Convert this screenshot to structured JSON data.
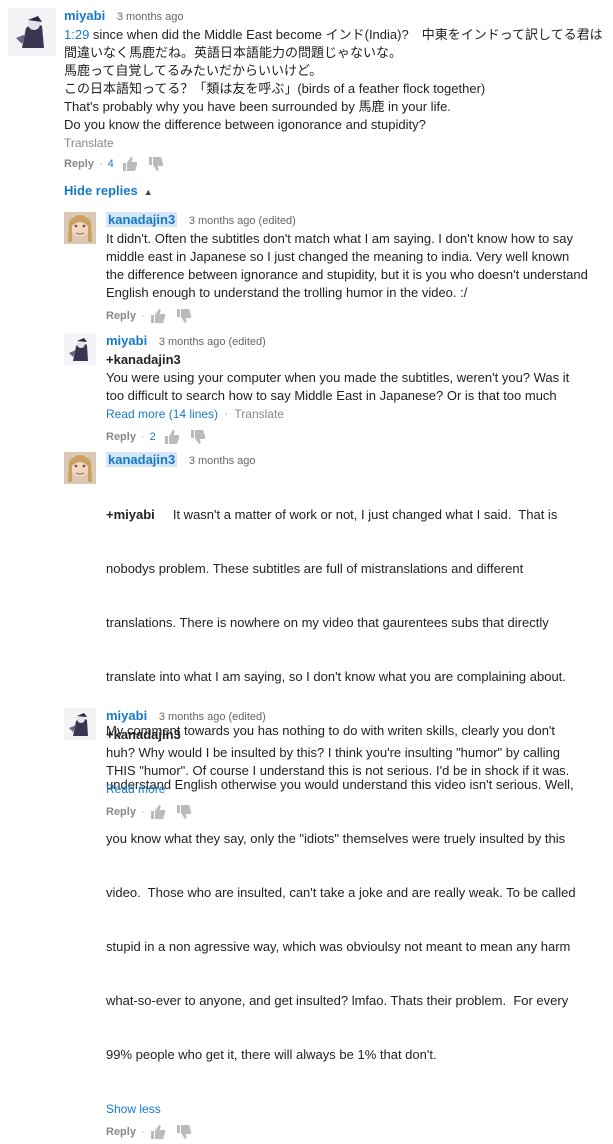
{
  "top_comment": {
    "author": "miyabi",
    "time": "3 months ago",
    "timestamp_link": "1:29",
    "lines": [
      " since when did the Middle East become インド(India)?　中東をインドって訳してる君は",
      "間違いなく馬鹿だね。英語日本語能力の問題じゃないな。",
      "馬鹿って自覚してるみたいだからいいけど。",
      "この日本語知ってる？「類は友を呼ぶ」(birds of a feather flock together)",
      "That's probably why you have been surrounded by 馬鹿 in your life.",
      "Do you know the difference between igonorance and stupidity?"
    ],
    "translate": "Translate",
    "reply_label": "Reply",
    "likes": "4"
  },
  "hide_replies_label": "Hide replies",
  "replies": [
    {
      "author": "kanadajin3",
      "time": "3 months ago (edited)",
      "lines": [
        "It didn't. Often the subtitles don't match what I am saying.  I don't know how to say",
        "middle east in Japanese so I just changed the meaning to india. Very well known",
        "the difference between ignorance and stupidity, but it is you who doesn't understand",
        "English enough to understand the trolling humor in the video. :/"
      ],
      "reply_label": "Reply"
    },
    {
      "author": "miyabi",
      "time": "3 months ago (edited)",
      "mention": "+kanadajin3",
      "lines": [
        "You were using your computer when you made the subtitles, weren't you? Was it",
        "too difficult to search how to say Middle East in Japanese? Or is that too much"
      ],
      "read_more": "Read more (14 lines)",
      "translate": "Translate",
      "reply_label": "Reply",
      "likes": "2"
    },
    {
      "author": "kanadajin3",
      "time": "3 months ago",
      "mention": "+miyabi",
      "first_line_rest": "     It wasn't a matter of work or not, I just changed what I said.  That is",
      "lines": [
        "nobodys problem. These subtitles are full of mistranslations and different",
        "translations. There is nowhere on my video that gaurentees subs that directly",
        "translate into what I am saying, so I don't know what you are complaining about.",
        "My comment towards you has nothing to do with writen skills, clearly you don't",
        "understand English otherwise you would understand this video isn't serious. Well,",
        "you know what they say, only the \"idiots\" themselves were truely insulted by this",
        "video.  Those who are insulted, can't take a joke and are really weak. To be called",
        "stupid in a non agressive way, which was obvioulsy not meant to mean any harm",
        "what-so-ever to anyone, and get insulted? lmfao. Thats their problem.  For every",
        "99% people who get it, there will always be 1% that don't."
      ],
      "show_less": "Show less",
      "reply_label": "Reply"
    },
    {
      "author": "miyabi",
      "time": "3 months ago (edited)",
      "mention": "+kanadajin3",
      "lines": [
        "huh? Why would I be insulted by this? I think you're insulting \"humor\" by calling",
        "THIS \"humor\". Of course I understand this is not serious. I'd be in shock if it was."
      ],
      "read_more": "Read more",
      "reply_label": "Reply"
    }
  ]
}
